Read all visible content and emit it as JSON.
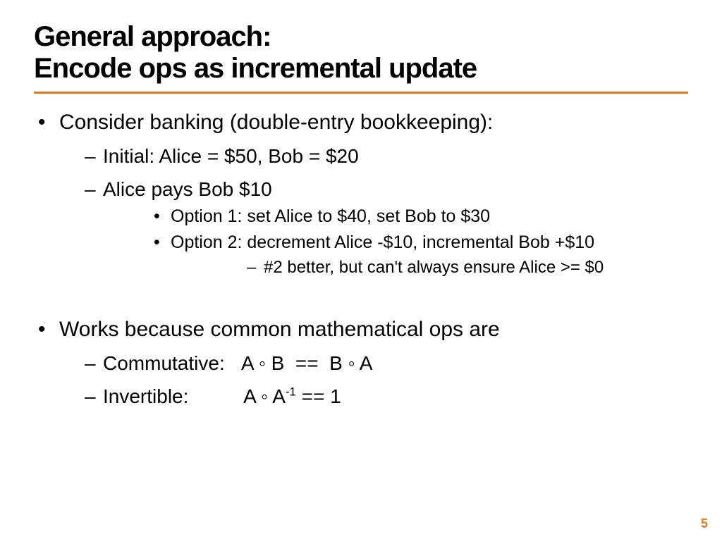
{
  "title_line1": "General approach:",
  "title_line2": "Encode ops as incremental update",
  "b1": "Consider banking (double-entry bookkeeping):",
  "b1a": "Initial:   Alice = $50,   Bob = $20",
  "b1b": "Alice pays Bob $10",
  "b1b_i": "Option 1:  set Alice to $40, set Bob to $30",
  "b1b_ii": "Option 2:  decrement Alice -$10, incremental Bob +$10",
  "b1b_ii_note": "#2 better, but can't always ensure Alice >= $0",
  "b2": "Works because common mathematical ops are",
  "b2a_html": "Commutative:&nbsp;&nbsp;&nbsp;A ◦ B&nbsp;&nbsp;==&nbsp;&nbsp;B ◦ A",
  "b2b_html": "Invertible:&nbsp;&nbsp;&nbsp;&nbsp;&nbsp;&nbsp;&nbsp;&nbsp;&nbsp;&nbsp;A ◦ A<sup>-1</sup> == 1",
  "page_number": "5"
}
